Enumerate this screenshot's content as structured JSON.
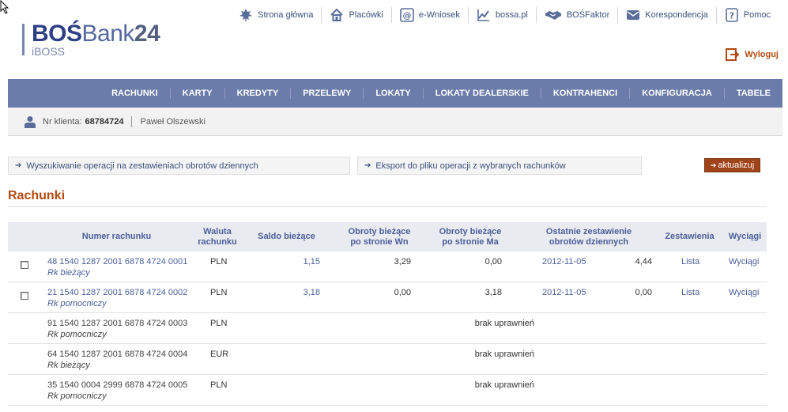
{
  "header": {
    "logo_part1": "BOŚ",
    "logo_part2": "Bank",
    "logo_part3": "24",
    "logo_sub": "iBOSS",
    "top_links": [
      {
        "label": "Strona główna",
        "icon": "maple-leaf-icon"
      },
      {
        "label": "Placówki",
        "icon": "home-icon"
      },
      {
        "label": "e-Wniosek",
        "icon": "at-sign-icon"
      },
      {
        "label": "bossa.pl",
        "icon": "chart-icon"
      },
      {
        "label": "BOŚFaktor",
        "icon": "handshake-icon"
      },
      {
        "label": "Korespondencja",
        "icon": "envelope-icon"
      },
      {
        "label": "Pomoc",
        "icon": "help-icon"
      }
    ],
    "logout_label": "Wyloguj"
  },
  "nav": {
    "items": [
      "RACHUNKI",
      "KARTY",
      "KREDYTY",
      "PRZELEWY",
      "LOKATY",
      "LOKATY DEALERSKIE",
      "KONTRAHENCI",
      "KONFIGURACJA",
      "TABELE"
    ]
  },
  "client": {
    "label": "Nr klienta:",
    "number": "68784724",
    "name": "Paweł Olszewski"
  },
  "actions": {
    "search_label": "Wyszukiwanie operacji na zestawieniach obrotów dziennych",
    "export_label": "Eksport do pliku operacji z wybranych rachunków",
    "refresh_label": "aktualizuj"
  },
  "page_title": "Rachunki",
  "table": {
    "headers": {
      "account": "Numer rachunku",
      "currency_1": "Waluta",
      "currency_2": "rachunku",
      "balance": "Saldo bieżące",
      "debit_1": "Obroty bieżące",
      "debit_2": "po stronie Wn",
      "credit_1": "Obroty bieżące",
      "credit_2": "po stronie Ma",
      "last_1": "Ostatnie zestawienie",
      "last_2": "obrotów dziennych",
      "statements": "Zestawienia",
      "extracts": "Wyciągi"
    },
    "rows": [
      {
        "account": "48 1540 1287 2001 6878 4724 0001",
        "type": "Rk bieżący",
        "currency": "PLN",
        "balance": "1,15",
        "debit": "3,29",
        "credit": "0,00",
        "last_date": "2012-11-05",
        "last_value": "4,44",
        "statements": "Lista",
        "extracts": "Wyciągi"
      },
      {
        "account": "21 1540 1287 2001 6878 4724 0002",
        "type": "Rk pomocniczy",
        "currency": "PLN",
        "balance": "3,18",
        "debit": "0,00",
        "credit": "3,18",
        "last_date": "2012-11-05",
        "last_value": "0,00",
        "statements": "Lista",
        "extracts": "Wyciągi"
      },
      {
        "account": "91 1540 1287 2001 6878 4724 0003",
        "type": "Rk pomocniczy",
        "currency": "PLN",
        "status": "brak uprawnień"
      },
      {
        "account": "64 1540 1287 2001 6878 4724 0004",
        "type": "Rk bieżący",
        "currency": "EUR",
        "status": "brak uprawnień"
      },
      {
        "account": "35 1540 0004 2999 6878 4724 0005",
        "type": "Rk pomocniczy",
        "currency": "PLN",
        "status": "brak uprawnień"
      }
    ]
  }
}
